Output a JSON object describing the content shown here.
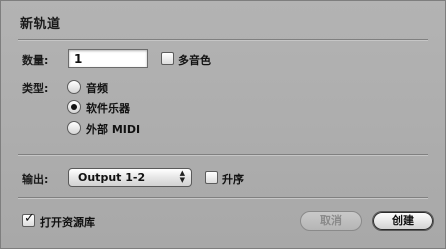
{
  "dialog": {
    "title": "新轨道",
    "count_label": "数量:",
    "count_value": "1",
    "multi_timbral_label": "多音色",
    "multi_timbral_checked": false,
    "type_label": "类型:",
    "type_options": [
      {
        "label": "音频",
        "selected": false
      },
      {
        "label": "软件乐器",
        "selected": true
      },
      {
        "label": "外部 MIDI",
        "selected": false
      }
    ],
    "output_label": "输出:",
    "output_value": "Output 1-2",
    "ascending_label": "升序",
    "ascending_checked": false,
    "open_library_label": "打开资源库",
    "open_library_checked": true,
    "cancel_label": "取消",
    "create_label": "创建"
  }
}
